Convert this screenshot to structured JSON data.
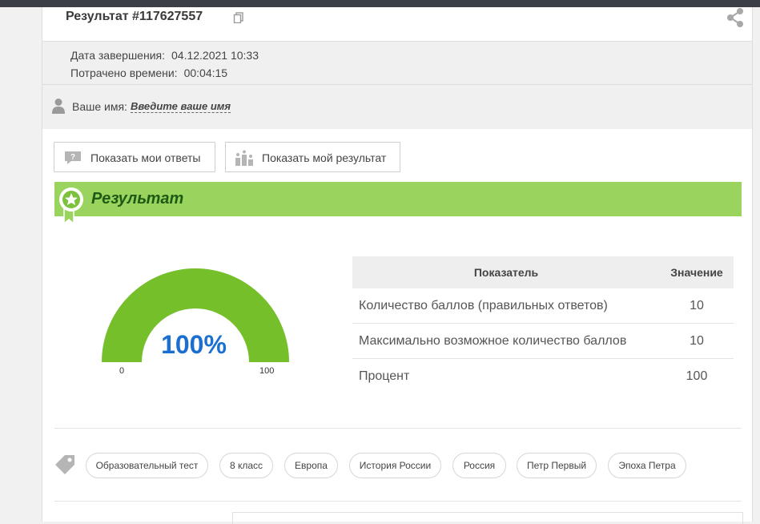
{
  "header": {
    "title": "Результат #117627557"
  },
  "meta": {
    "finish_label": "Дата завершения:",
    "finish_value": "04.12.2021 10:33",
    "spent_label": "Потрачено времени:",
    "spent_value": "00:04:15"
  },
  "name": {
    "label": "Ваше имя:",
    "placeholder": "Введите ваше имя"
  },
  "buttons": {
    "answers": "Показать мои ответы",
    "result": "Показать мой результат"
  },
  "result": {
    "title": "Результат",
    "gauge": {
      "percent_text": "100%",
      "min": "0",
      "max": "100",
      "fraction": 1.0
    }
  },
  "table": {
    "headers": [
      "Показатель",
      "Значение"
    ],
    "rows": [
      {
        "label": "Количество баллов (правильных ответов)",
        "value": "10"
      },
      {
        "label": "Максимально возможное количество баллов",
        "value": "10"
      },
      {
        "label": "Процент",
        "value": "100"
      }
    ]
  },
  "tags": [
    "Образовательный тест",
    "8 класс",
    "Европа",
    "История России",
    "Россия",
    "Петр Первый",
    "Эпоха Петра"
  ],
  "colors": {
    "accent_green": "#9ad45f",
    "gauge_green": "#75c02a",
    "percent_blue": "#1a6fd0",
    "title_green": "#1e5a14"
  }
}
